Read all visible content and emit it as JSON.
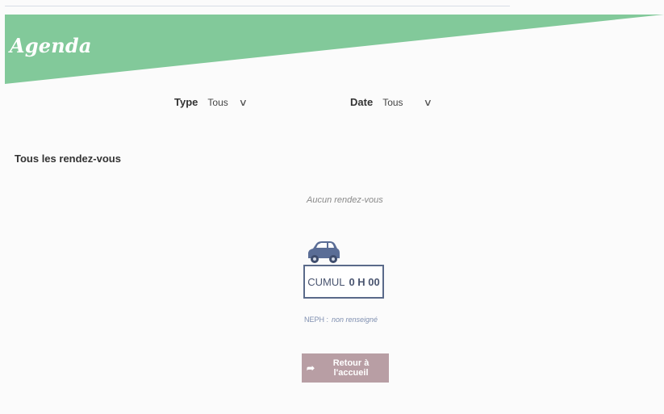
{
  "header": {
    "title": "Agenda",
    "banner_color": "#82c99a"
  },
  "filters": {
    "type": {
      "label": "Type",
      "value": "Tous"
    },
    "date": {
      "label": "Date",
      "value": "Tous"
    }
  },
  "section": {
    "title": "Tous les rendez-vous",
    "empty_message": "Aucun rendez-vous"
  },
  "cumul": {
    "label": "CUMUL",
    "value": "0 H 00",
    "icon": "car-icon"
  },
  "neph": {
    "label": "NEPH :",
    "value": "non renseigné"
  },
  "actions": {
    "home_label": "Retour à l'accueil",
    "home_icon": "share-arrow-icon",
    "home_color": "#b89ea4"
  }
}
